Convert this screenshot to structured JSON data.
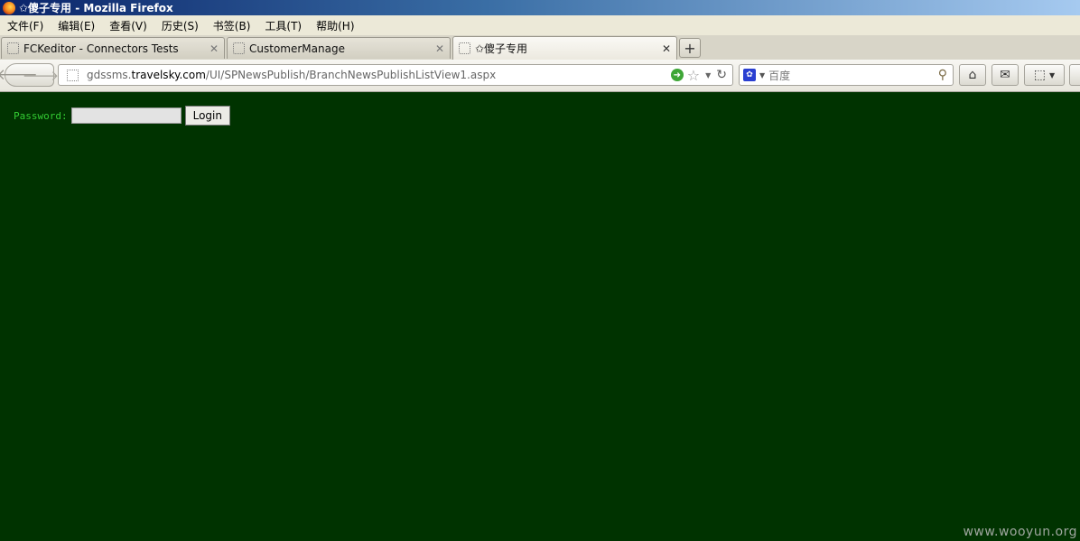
{
  "window": {
    "title": "✩傻子专用 - Mozilla Firefox"
  },
  "menubar": {
    "items": [
      "文件(F)",
      "编辑(E)",
      "查看(V)",
      "历史(S)",
      "书签(B)",
      "工具(T)",
      "帮助(H)"
    ]
  },
  "tabs": [
    {
      "label": "FCKeditor - Connectors Tests",
      "active": false
    },
    {
      "label": "CustomerManage",
      "active": false
    },
    {
      "label": "✩傻子专用",
      "active": true
    }
  ],
  "newtab_symbol": "+",
  "navbar": {
    "url_prefix": "gdssms.",
    "url_host": "travelsky.com",
    "url_path": "/UI/SPNewsPublish/BranchNewsPublishListView1.aspx",
    "search_placeholder": "百度"
  },
  "icons": {
    "back": "back-arrow-icon",
    "forward": "forward-arrow-icon",
    "go": "go-arrow-icon",
    "bookmark": "star-icon",
    "reload": "reload-icon",
    "search_engine": "baidu-paw-icon",
    "magnifier": "magnifier-icon",
    "home": "home-icon",
    "mail": "mail-icon",
    "screenshot": "screenshot-icon"
  },
  "page": {
    "password_label": "Password:",
    "password_value": "",
    "login_button": "Login",
    "watermark": "www.wooyun.org"
  },
  "colors": {
    "page_background": "#003300",
    "label_green": "#33cc33"
  }
}
